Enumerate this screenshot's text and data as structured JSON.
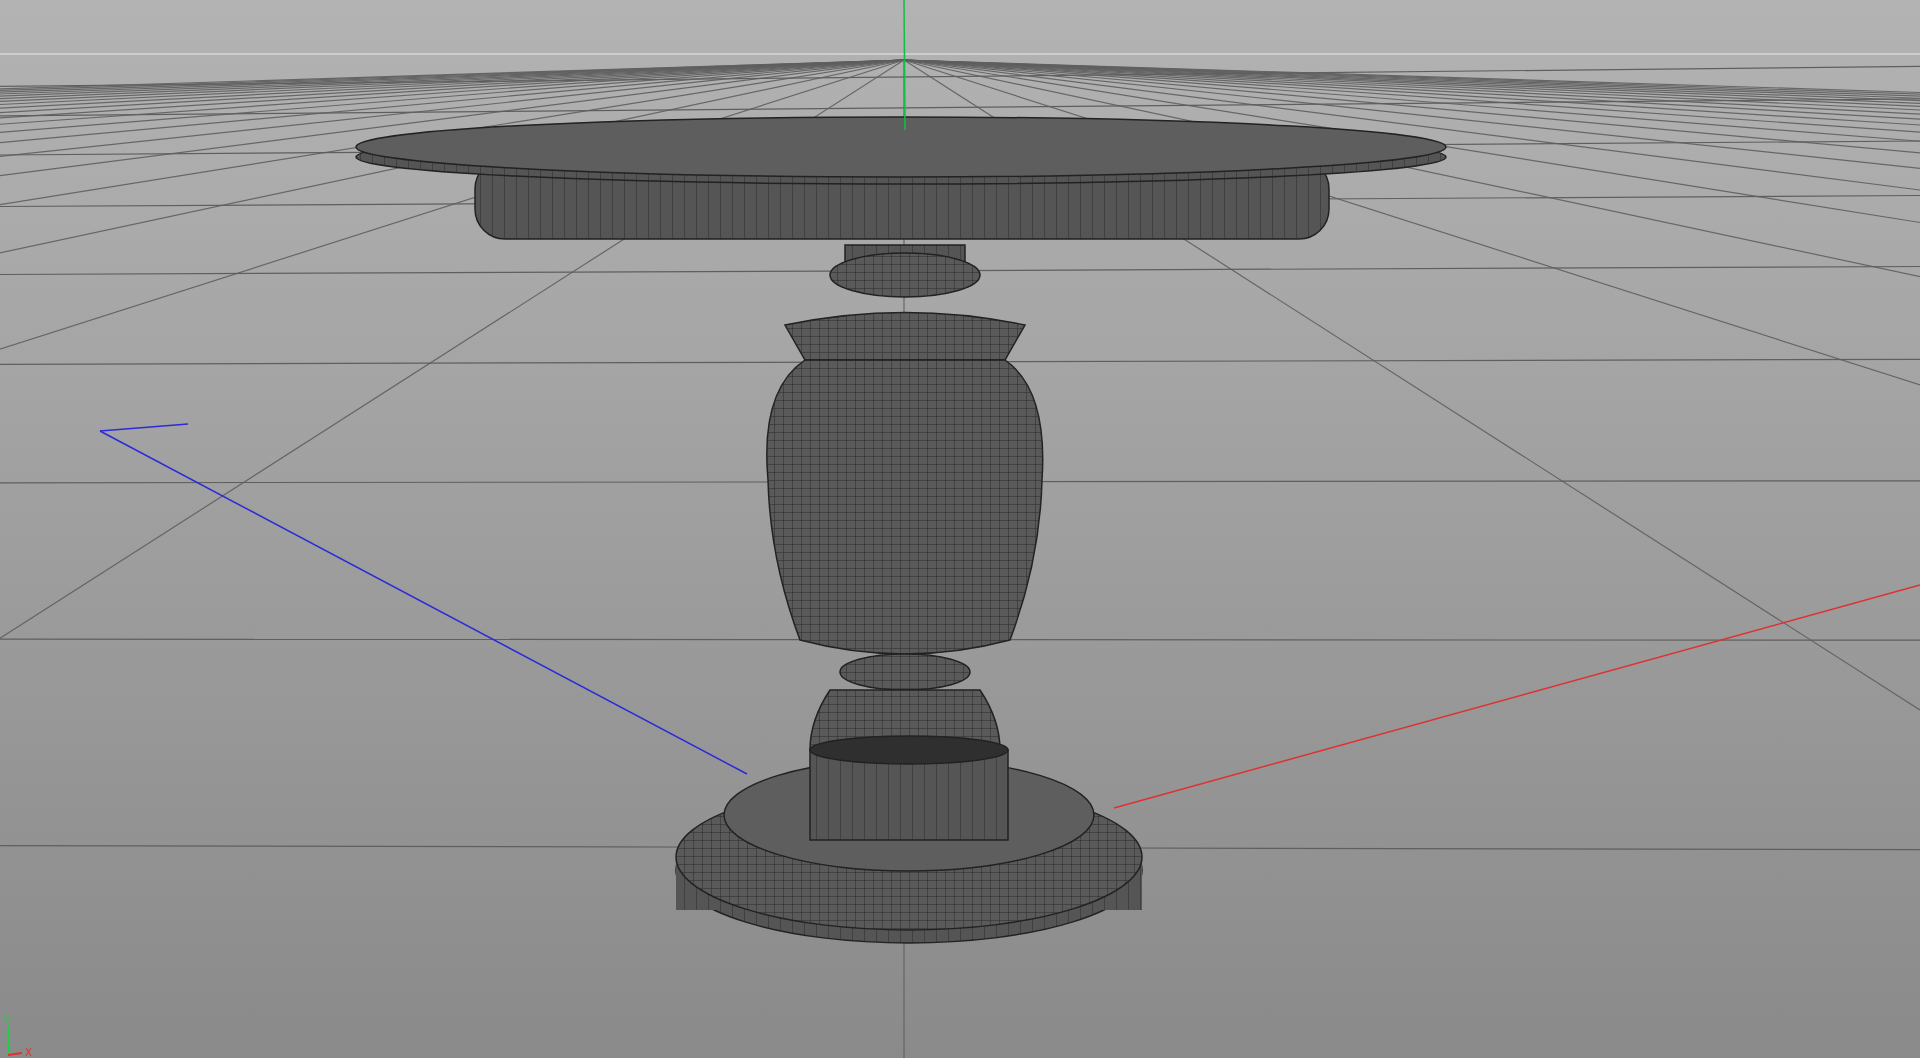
{
  "viewport": {
    "axis_gizmo": {
      "y_label": "Y",
      "x_label": "X"
    }
  }
}
